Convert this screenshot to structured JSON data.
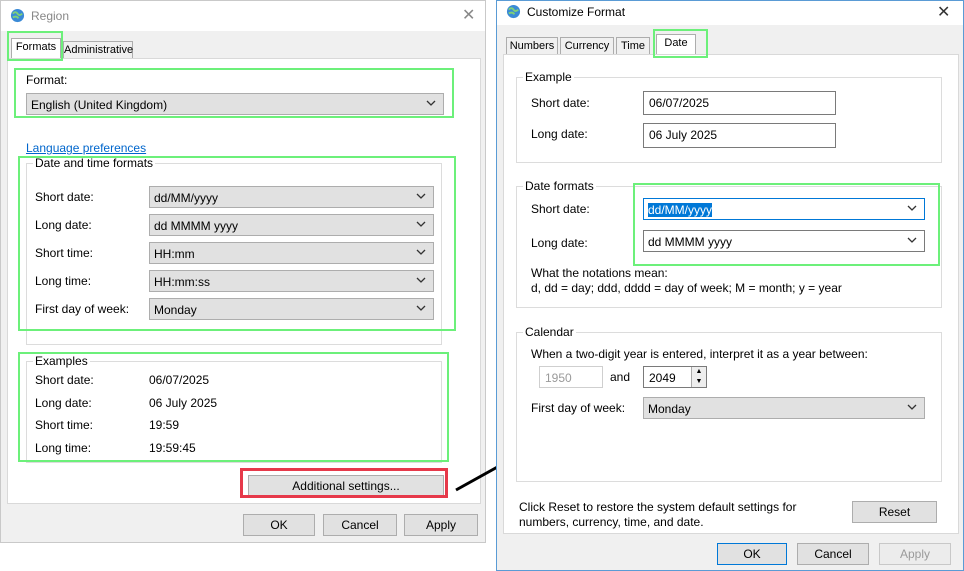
{
  "region": {
    "title": "Region",
    "tabs": [
      "Formats",
      "Administrative"
    ],
    "format_label": "Format:",
    "format_value": "English (United Kingdom)",
    "language_link": "Language preferences",
    "datetime_group": "Date and time formats",
    "short_date_label": "Short date:",
    "short_date_value": "dd/MM/yyyy",
    "long_date_label": "Long date:",
    "long_date_value": "dd MMMM yyyy",
    "short_time_label": "Short time:",
    "short_time_value": "HH:mm",
    "long_time_label": "Long time:",
    "long_time_value": "HH:mm:ss",
    "first_day_label": "First day of week:",
    "first_day_value": "Monday",
    "examples_group": "Examples",
    "ex_short_date_label": "Short date:",
    "ex_short_date": "06/07/2025",
    "ex_long_date_label": "Long date:",
    "ex_long_date": "06 July 2025",
    "ex_short_time_label": "Short time:",
    "ex_short_time": "19:59",
    "ex_long_time_label": "Long time:",
    "ex_long_time": "19:59:45",
    "additional_button": "Additional settings...",
    "ok": "OK",
    "cancel": "Cancel",
    "apply": "Apply"
  },
  "customize": {
    "title": "Customize Format",
    "tabs": [
      "Numbers",
      "Currency",
      "Time",
      "Date"
    ],
    "example_group": "Example",
    "ex_short_label": "Short date:",
    "ex_short_value": "06/07/2025",
    "ex_long_label": "Long date:",
    "ex_long_value": "06 July 2025",
    "formats_group": "Date formats",
    "short_label": "Short date:",
    "short_value": "dd/MM/yyyy",
    "long_label": "Long date:",
    "long_value": "dd MMMM yyyy",
    "notation_title": "What the notations mean:",
    "notation_text": "d, dd = day;  ddd, dddd = day of week;  M = month;  y = year",
    "calendar_group": "Calendar",
    "twodigit_label": "When a two-digit year is entered, interpret it as a year between:",
    "year_from": "1950",
    "and_label": "and",
    "year_to": "2049",
    "first_day_label": "First day of week:",
    "first_day_value": "Monday",
    "reset_text": "Click Reset to restore the system default settings for numbers, currency, time, and date.",
    "reset_button": "Reset",
    "ok": "OK",
    "cancel": "Cancel",
    "apply": "Apply"
  },
  "colors": {
    "highlight": "#6cf07a",
    "highlight_red": "#e6394a",
    "accent": "#0078d7"
  }
}
